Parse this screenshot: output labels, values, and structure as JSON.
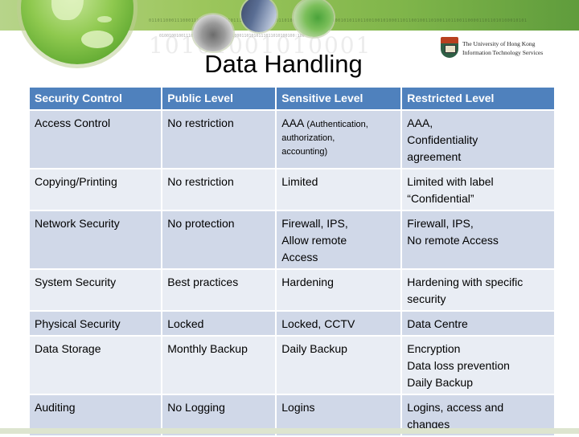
{
  "banner": {
    "bits_top": "01101100011100011011010001001011100011010001101101000110110000101100101011011001001010001101100100110100110110011000011011010100010101",
    "bits_bottom": "0100100100111010101:101001000010001101010111011010100100:100",
    "watermark": "10101001010001"
  },
  "logo": {
    "line1": "The University of Hong Kong",
    "line2": "Information Technology Services"
  },
  "page_title": "Data Handling",
  "table": {
    "headers": [
      "Security Control",
      "Public Level",
      "Sensitive Level",
      "Restricted Level"
    ],
    "rows": [
      {
        "control": "Access Control",
        "public": [
          "No restriction"
        ],
        "sensitive_main": "AAA",
        "sensitive_note": [
          "(Authentication,",
          "authorization,",
          "accounting)"
        ],
        "restricted": [
          "AAA,",
          "Confidentiality",
          "agreement"
        ]
      },
      {
        "control": "Copying/Printing",
        "public": [
          "No restriction"
        ],
        "sensitive": [
          "Limited"
        ],
        "restricted": [
          "Limited with label",
          "“Confidential”"
        ]
      },
      {
        "control": "Network Security",
        "public": [
          "No protection"
        ],
        "sensitive": [
          "Firewall, IPS,",
          "Allow remote",
          "Access"
        ],
        "restricted": [
          "Firewall, IPS,",
          "No remote Access"
        ]
      },
      {
        "control": "System Security",
        "public": [
          "Best practices"
        ],
        "sensitive": [
          "Hardening"
        ],
        "restricted": [
          "Hardening with specific",
          "security"
        ]
      },
      {
        "control": "Physical Security",
        "public": [
          "Locked"
        ],
        "sensitive": [
          "Locked, CCTV"
        ],
        "restricted": [
          "Data Centre"
        ]
      },
      {
        "control": "Data Storage",
        "public": [
          "Monthly Backup"
        ],
        "sensitive": [
          "Daily Backup"
        ],
        "restricted": [
          "Encryption",
          "Data loss prevention",
          "Daily Backup"
        ]
      },
      {
        "control": "Auditing",
        "public": [
          "No Logging"
        ],
        "sensitive": [
          "Logins"
        ],
        "restricted": [
          "Logins, access and",
          "changes"
        ]
      }
    ]
  },
  "colors": {
    "header_bg": "#4f81bd",
    "row_odd_bg": "#d0d8e8",
    "row_even_bg": "#e9edf4",
    "banner_green": "#7fb54a"
  }
}
